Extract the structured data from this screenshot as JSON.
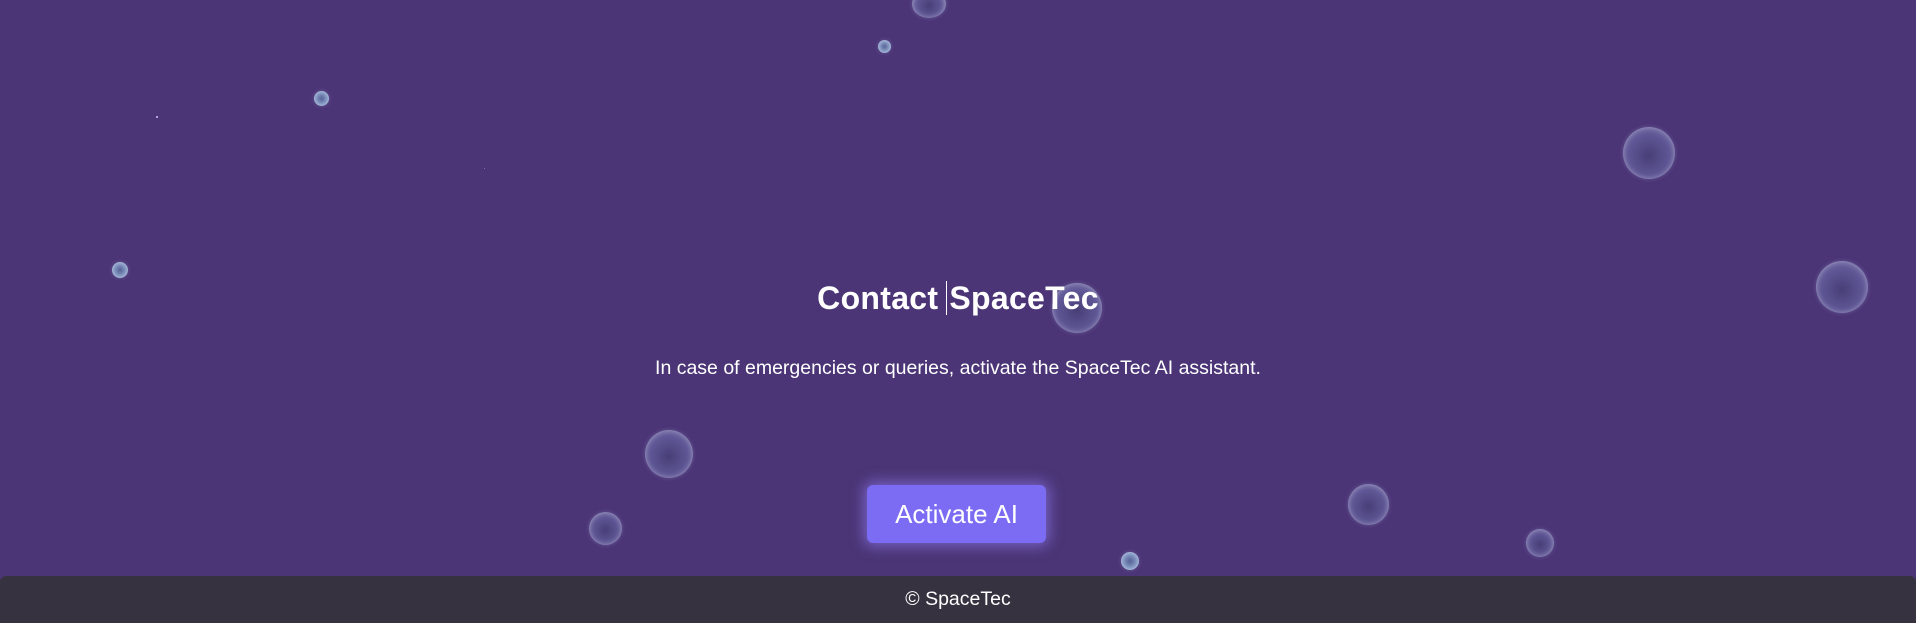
{
  "header": {
    "title_part1": "Contact",
    "title_part2": "SpaceTec"
  },
  "main": {
    "subtitle": "In case of emergencies or queries, activate the SpaceTec AI assistant.",
    "activate_button_label": "Activate AI"
  },
  "footer": {
    "text": "© SpaceTec"
  },
  "colors": {
    "background": "#4b3576",
    "button": "#7b6cf3",
    "footer": "#37323f"
  }
}
